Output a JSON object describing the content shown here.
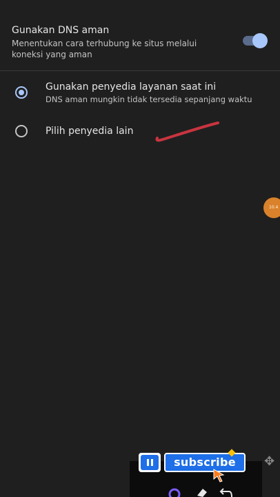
{
  "secure_dns": {
    "title": "Gunakan DNS aman",
    "description": "Menentukan cara terhubung ke situs melalui koneksi yang aman",
    "enabled": true
  },
  "options": [
    {
      "label": "Gunakan penyedia layanan saat ini",
      "sublabel": "DNS aman mungkin tidak tersedia sepanjang waktu",
      "selected": true
    },
    {
      "label": "Pilih penyedia lain",
      "selected": false
    }
  ],
  "overlay": {
    "subscribe_label": "subscribe",
    "floating_badge_text": "10.4"
  },
  "colors": {
    "background": "#1f1f1f",
    "accent": "#a8c7fa",
    "annotation": "#c8343f",
    "subscribe": "#1e6fe8",
    "badge": "#d9822b"
  },
  "icons": {
    "pause": "pause-icon",
    "move": "move-icon",
    "cursor": "cursor-arrow-icon",
    "color": "color-wheel-icon",
    "eraser": "eraser-icon",
    "undo": "undo-icon"
  }
}
